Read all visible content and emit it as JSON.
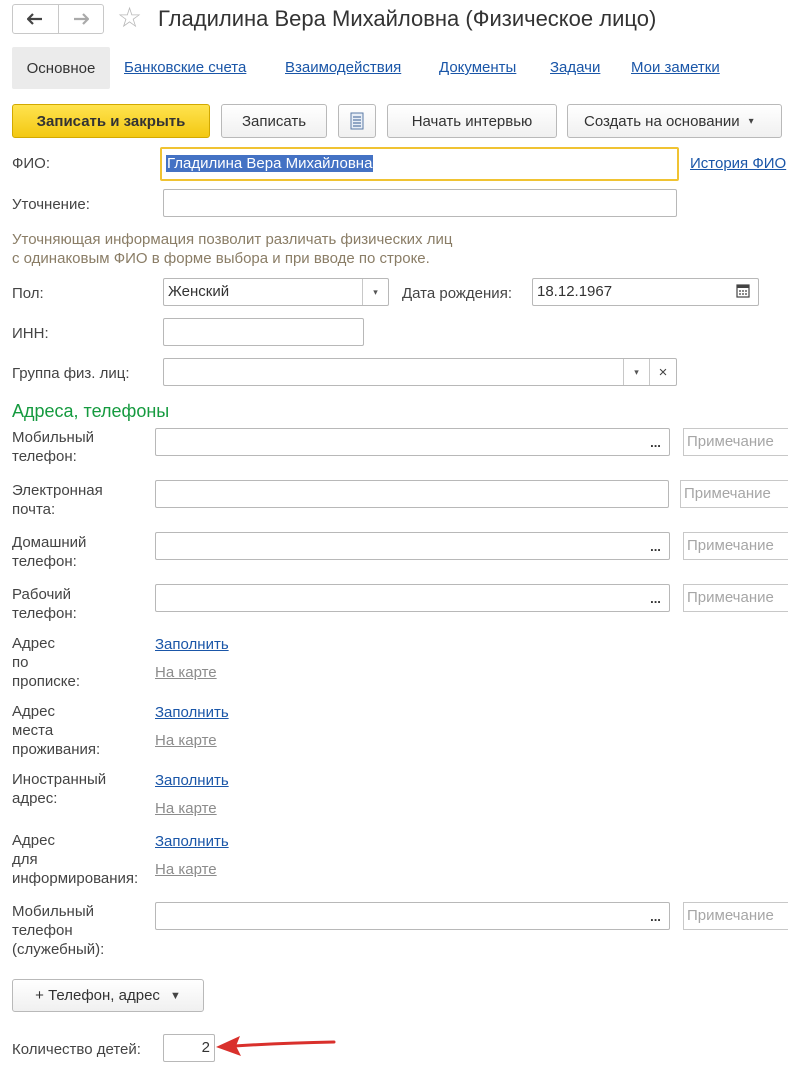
{
  "window": {
    "title": "Гладилина Вера Михайловна (Физическое лицо)",
    "back_icon": "arrow-left-icon",
    "forward_icon": "arrow-right-icon",
    "favorite_icon": "star-icon"
  },
  "tabs": {
    "active": "Основное",
    "links": [
      "Банковские счета",
      "Взаимодействия",
      "Документы",
      "Задачи",
      "Мои заметки"
    ]
  },
  "toolbar": {
    "save_close": "Записать и закрыть",
    "save": "Записать",
    "report_icon": "document-list-icon",
    "start_interview": "Начать интервью",
    "create_based": "Создать на основании",
    "create_based_arrow": "▾"
  },
  "form": {
    "fio_label": "ФИО:",
    "fio_value": "Гладилина Вера Михайловна",
    "fio_history": "История ФИО",
    "clarification_label": "Уточнение:",
    "clarification_value": "",
    "hint_line1": "Уточняющая информация позволит различать физических лиц",
    "hint_line2": "с одинаковым ФИО в форме выбора и при вводе по строке.",
    "gender_label": "Пол:",
    "gender_value": "Женский",
    "birth_label": "Дата рождения:",
    "birth_value": "18.12.1967",
    "inn_label": "ИНН:",
    "inn_value": "",
    "group_label": "Группа физ. лиц:",
    "group_value": "",
    "clear_icon": "×",
    "dropdown_icon": "▾"
  },
  "contacts": {
    "section_title": "Адреса, телефоны",
    "note_placeholder": "Примечание",
    "dots": "...",
    "mobile_label_1": "Мобильный",
    "mobile_label_2": "телефон:",
    "email_label_1": "Электронная",
    "email_label_2": "почта:",
    "home_label_1": "Домашний",
    "home_label_2": "телефон:",
    "work_label_1": "Рабочий",
    "work_label_2": "телефон:",
    "reg_label_1": "Адрес",
    "reg_label_2": "по",
    "reg_label_3": "прописке:",
    "res_label_1": "Адрес",
    "res_label_2": "места",
    "res_label_3": "проживания:",
    "foreign_label_1": "Иностранный",
    "foreign_label_2": "адрес:",
    "info_label_1": "Адрес",
    "info_label_2": "для",
    "info_label_3": "информирования:",
    "mobile_work_label_1": "Мобильный",
    "mobile_work_label_2": "телефон",
    "mobile_work_label_3": "(служебный):",
    "fill_link": "Заполнить",
    "map_link": "На карте",
    "add_button": "+ Телефон, адрес",
    "add_button_arrow": "▼"
  },
  "children": {
    "label": "Количество детей:",
    "value": "2"
  },
  "colors": {
    "accent_yellow": "#f3c812",
    "link_blue": "#1a56a8",
    "section_green": "#159a3f",
    "annotation_red": "#d9302c"
  }
}
